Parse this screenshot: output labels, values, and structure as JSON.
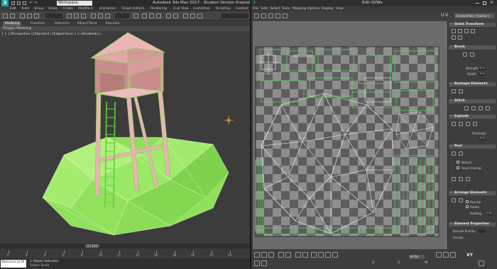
{
  "max": {
    "logo": "3",
    "workspace": "Workspace: Default",
    "title": "Autodesk 3ds Max 2017 - Student Version",
    "file": "Krepost_reco",
    "menus": [
      "Edit",
      "Tools",
      "Group",
      "Views",
      "Create",
      "Modifiers",
      "Animation",
      "Graph Editors",
      "Rendering",
      "Civil View",
      "Customize",
      "Scripting",
      "Content",
      "Help"
    ],
    "ribbon_tabs": [
      "Modeling",
      "Freeform",
      "Selection",
      "Object Paint",
      "Populate"
    ],
    "ribbon_sub": "Polygon Modeling",
    "viewport_label": "[ + ] [Perspective ] [Standard ] [Edged Faces ]  <<Disabled>>",
    "time_slider": "0 / 100",
    "ticks": [
      "0",
      "2",
      "4",
      "6",
      "8",
      "10",
      "12",
      "14",
      "16",
      "18",
      "20",
      "22",
      "24"
    ],
    "maxscript_text": "Welcome to M",
    "status_line1": "1 Object Selected",
    "status_line2": "Select Scale"
  },
  "uvw": {
    "logo": "3",
    "title": "Edit UVWs",
    "menus": [
      "File",
      "Edit",
      "Select",
      "Tools",
      "Mapping",
      "Options",
      "Display",
      "View"
    ],
    "u_icon": "U",
    "v_icon": "V",
    "checker": "CheckerPatt ( Checker )",
    "xy": "XY",
    "u_label": "U:",
    "v_label": "V:",
    "w_label": "W:",
    "all_ids": "All IDs",
    "panel": {
      "quick_transform": "Quick Transform",
      "brush": "Brush",
      "strength_label": "Strength:",
      "strength_val": "50.0",
      "falloff_label": "Falloff:",
      "falloff_val": "20.0",
      "reshape": "Reshape Elements",
      "stitch": "Stitch",
      "explode": "Explode",
      "threshold_label": "Threshold:",
      "threshold_val": "15.0",
      "peel": "Peel",
      "detach_label": "Detach",
      "avoid_overlap_label": "Avoid Overlap",
      "arrange": "Arrange Elements",
      "rescale_label": "Rescale",
      "rotate_label": "Rotate",
      "padding_label": "Padding:",
      "padding_val": "0.02",
      "element_props": "Element Properties",
      "rescale_priority": "Rescale Priority:",
      "groups": "Groups:"
    }
  }
}
